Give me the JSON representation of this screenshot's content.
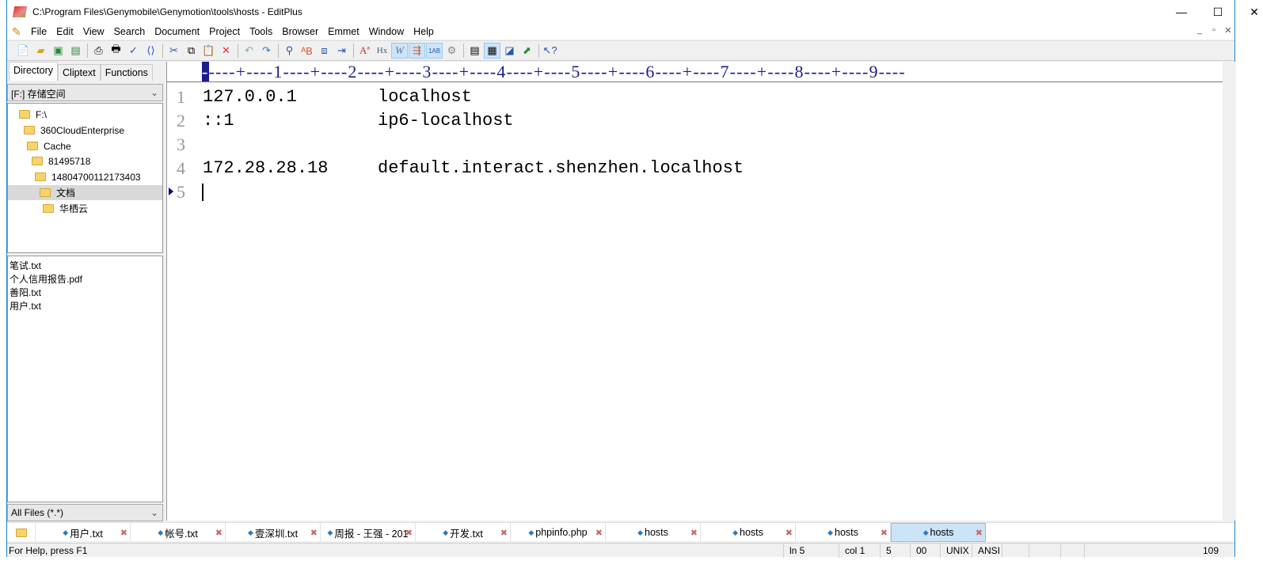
{
  "window": {
    "title": "C:\\Program Files\\Genymobile\\Genymotion\\tools\\hosts - EditPlus",
    "minimize": "—",
    "maximize": "☐",
    "close": "✕"
  },
  "menu": [
    "File",
    "Edit",
    "View",
    "Search",
    "Document",
    "Project",
    "Tools",
    "Browser",
    "Emmet",
    "Window",
    "Help"
  ],
  "toolbar_icons": [
    "new-file-icon",
    "open-icon",
    "save-icon",
    "save-all-icon",
    "print-preview-icon",
    "print-icon",
    "spellcheck-icon",
    "browser-preview-icon",
    "cut-icon",
    "copy-icon",
    "paste-icon",
    "delete-icon",
    "undo-icon",
    "redo-icon",
    "find-icon",
    "replace-icon",
    "find-in-files-icon",
    "goto-line-icon",
    "font-icon",
    "hx-icon",
    "word-wrap-icon",
    "indent-icon",
    "line-number-icon",
    "settings-icon",
    "directory-window-icon",
    "output-window-icon",
    "cliptext-icon",
    "fullscreen-icon",
    "help-icon"
  ],
  "left_panel": {
    "tabs": [
      "Directory",
      "Cliptext",
      "Functions"
    ],
    "drive": "[F:] 存储空间",
    "tree": [
      "F:\\",
      "360CloudEnterprise",
      "Cache",
      "81495718",
      "14804700112173403",
      "文档",
      "华栖云"
    ],
    "files": [
      "笔试.txt",
      "个人信用报告.pdf",
      "善阳.txt",
      "用户.txt"
    ],
    "filter": "All Files (*.*)"
  },
  "editor": {
    "ruler": "----+----1----+----2----+----3----+----4----+----5----+----6----+----7----+----8----+----9----",
    "lines": [
      {
        "n": "1",
        "ip": "127.0.0.1",
        "host": "localhost"
      },
      {
        "n": "2",
        "ip": "::1",
        "host": "ip6-localhost"
      },
      {
        "n": "3",
        "ip": "",
        "host": ""
      },
      {
        "n": "4",
        "ip": "172.28.28.18",
        "host": "default.interact.shenzhen.localhost"
      },
      {
        "n": "5",
        "ip": "",
        "host": ""
      }
    ]
  },
  "doc_tabs": [
    "用户.txt",
    "帐号.txt",
    "壹深圳.txt",
    "周报 - 王强 - 201",
    "开发.txt",
    "phpinfo.php",
    "hosts",
    "hosts",
    "hosts",
    "hosts"
  ],
  "status": {
    "help": "For Help, press F1",
    "ln": "ln 5",
    "col": "col 1",
    "lines": "5",
    "code": "00",
    "eol": "UNIX",
    "encoding": "ANSI",
    "num": "109"
  }
}
